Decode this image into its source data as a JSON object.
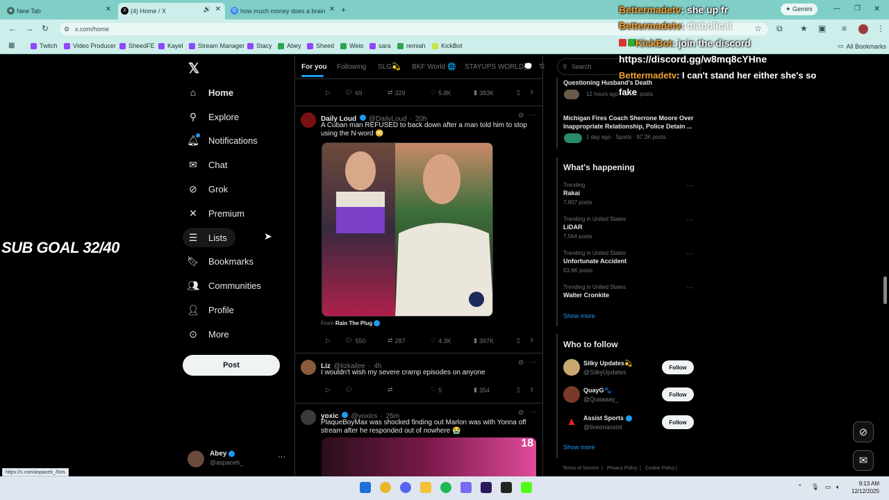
{
  "browser": {
    "tabs": [
      {
        "label": "New Tab"
      },
      {
        "label": "(4) Home / X"
      },
      {
        "label": "how much money does a brain"
      }
    ],
    "url": "x.com/home",
    "gemini_label": "Gemini",
    "bookmarks": [
      {
        "label": "Twitch",
        "color": "#9146ff"
      },
      {
        "label": "Video Producer",
        "color": "#9146ff"
      },
      {
        "label": "SheedFE",
        "color": "#9146ff"
      },
      {
        "label": "Kayel",
        "color": "#9146ff"
      },
      {
        "label": "Stream Manager",
        "color": "#9146ff"
      },
      {
        "label": "Stacy",
        "color": "#9146ff"
      },
      {
        "label": "Abey",
        "color": "#2ca44e"
      },
      {
        "label": "Sheed",
        "color": "#9146ff"
      },
      {
        "label": "Weio",
        "color": "#2ca44e"
      },
      {
        "label": "sara",
        "color": "#9146ff"
      },
      {
        "label": "remiah",
        "color": "#2ca44e"
      },
      {
        "label": "KickBot",
        "color": "#c7e84a"
      }
    ],
    "all_bookmarks": "All Bookmarks"
  },
  "sidebar": {
    "items": [
      {
        "label": "Home",
        "icon": "house-icon"
      },
      {
        "label": "Explore",
        "icon": "search-icon"
      },
      {
        "label": "Notifications",
        "icon": "bell-icon"
      },
      {
        "label": "Chat",
        "icon": "mail-icon"
      },
      {
        "label": "Grok",
        "icon": "grok-icon"
      },
      {
        "label": "Premium",
        "icon": "x-logo-icon"
      },
      {
        "label": "Lists",
        "icon": "list-icon"
      },
      {
        "label": "Bookmarks",
        "icon": "bookmark-icon"
      },
      {
        "label": "Communities",
        "icon": "people-icon"
      },
      {
        "label": "Profile",
        "icon": "person-icon"
      },
      {
        "label": "More",
        "icon": "more-circle-icon"
      }
    ],
    "post_label": "Post",
    "account": {
      "name": "Abey",
      "handle": "@aspaceb_"
    }
  },
  "feed": {
    "tabs": [
      "For you",
      "Following",
      "SLG💫",
      "BKF World 🌐",
      "STAYUPS WORLD💭",
      "Ti"
    ],
    "top_actions": {
      "replies": "69",
      "reposts": "329",
      "likes": "5.8K",
      "views": "383K"
    },
    "posts": [
      {
        "name": "Daily Loud",
        "handle": "@DailyLoud",
        "time": "20h",
        "text": "A Cuban man REFUSED to back down after a man told him to stop using the N-word 😳",
        "from_label": "From",
        "from_account": "Rain The Plug",
        "replies": "550",
        "reposts": "287",
        "likes": "4.3K",
        "views": "397K"
      },
      {
        "name": "Liz",
        "handle": "@lizkailee",
        "time": "4h",
        "text": "I wouldn't wish my severe cramp episodes on anyone",
        "replies": "",
        "reposts": "",
        "likes": "5",
        "views": "354"
      },
      {
        "name": "yoxic",
        "handle": "@yoxics",
        "time": "25m",
        "text": "PlaqueBoyMax was shocked finding out Marlon was with Yonna off stream after he responded out of nowhere 😭",
        "video_badge": "18"
      }
    ]
  },
  "right": {
    "search_placeholder": "Search",
    "news": [
      {
        "title": "Questioning Husband's Death",
        "meta": "12 hours ago · 10.8K posts"
      },
      {
        "title": "Michigan Fires Coach Sherrone Moore Over Inappropriate Relationship, Police Detain ...",
        "meta": "1 day ago · Sports · 97.2K posts"
      }
    ],
    "whats_happening": "What's happening",
    "trends": [
      {
        "meta": "Trending",
        "name": "Rakai",
        "posts": "7,907 posts"
      },
      {
        "meta": "Trending in United States",
        "name": "LiDAR",
        "posts": "7,564 posts"
      },
      {
        "meta": "Trending in United States",
        "name": "Unfortunate Accident",
        "posts": "53.6K posts"
      },
      {
        "meta": "Trending in United States",
        "name": "Walter Cronkite",
        "posts": ""
      }
    ],
    "show_more": "Show more",
    "who_to_follow": "Who to follow",
    "suggestions": [
      {
        "name": "Silky Updates💫",
        "handle": "@SilkyUpdates",
        "button": "Follow"
      },
      {
        "name": "QuayG🐾",
        "handle": "@Quaaaay_",
        "button": "Follow"
      },
      {
        "name": "Assist Sports",
        "handle": "@liveonassist",
        "button": "Follow"
      }
    ],
    "footer": [
      "Terms of Service",
      "|",
      "Privacy Policy",
      "|",
      "Cookie Policy",
      "|"
    ]
  },
  "overlay": {
    "chat": [
      {
        "name": "Bettermadetv",
        "msg": "she up fr"
      },
      {
        "name": "Bettermadetv",
        "msg": "diabolical"
      },
      {
        "name": "KickBot",
        "msg": "join the discord"
      },
      {
        "name": "",
        "msg": "https://discord.gg/w8mq8cYHne"
      },
      {
        "name": "Bettermadetv",
        "msg": "I can't stand her either she's so"
      },
      {
        "name": "",
        "msg": "fake"
      }
    ],
    "sub_goal": "SUB GOAL 32/40"
  },
  "status_url": "https://x.com/aspaceb_/lists",
  "taskbar": {
    "time": "9:13 AM",
    "date": "12/12/2025"
  }
}
